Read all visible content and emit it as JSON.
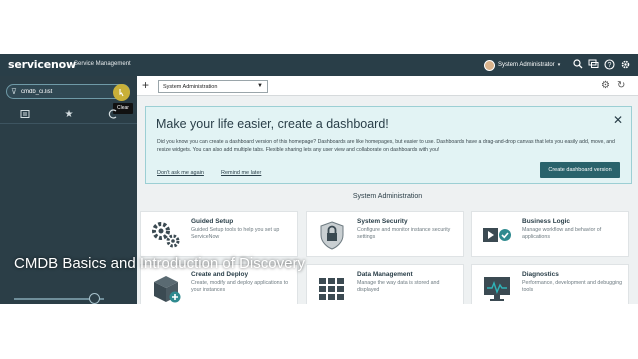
{
  "topbar": {
    "logo": "servicenow",
    "product": "Service Management",
    "user_name": "System Administrator",
    "user_caret": "▾",
    "icons": [
      "search-icon",
      "chat-icon",
      "help-icon",
      "gear-icon"
    ]
  },
  "leftnav": {
    "filter_value": "cmdb_ci.list",
    "filter_icon": "⊽",
    "clear_tooltip": "Clear",
    "tabs": [
      "history-icon",
      "star-icon",
      "clock-icon"
    ]
  },
  "tabbar": {
    "add_label": "+",
    "dashboard_selected": "System Administration",
    "caret": "▼",
    "gear": "⚙",
    "refresh": "↻"
  },
  "banner": {
    "title": "Make your life easier, create a dashboard!",
    "close": "✕",
    "body": "Did you know you can create a dashboard version of this homepage? Dashboards are like homepages, but easier to use. Dashboards have a drag-and-drop canvas that lets you easily add, move, and resize widgets. You can also add multiple tabs. Flexible sharing lets any user view and collaborate on dashboards with you!",
    "dismiss_label": "Don't ask me again",
    "remind_label": "Remind me later",
    "create_label": "Create dashboard version"
  },
  "section": {
    "title": "System Administration"
  },
  "cards": [
    {
      "title": "Guided Setup",
      "desc": "Guided Setup tools to help you set up ServiceNow",
      "icon": "gears-icon"
    },
    {
      "title": "System Security",
      "desc": "Configure and monitor instance security settings",
      "icon": "shield-icon"
    },
    {
      "title": "Business Logic",
      "desc": "Manage workflow and behavior of applications",
      "icon": "play-check-icon"
    },
    {
      "title": "Create and Deploy",
      "desc": "Create, modify and deploy applications to your instances",
      "icon": "box-add-icon"
    },
    {
      "title": "Data Management",
      "desc": "Manage the way data is stored and displayed",
      "icon": "grid-icon"
    },
    {
      "title": "Diagnostics",
      "desc": "Performance, development and debugging tools",
      "icon": "monitor-icon"
    }
  ],
  "caption": "CMDB Basics and Introduction of Discovery",
  "colors": {
    "header": "#293e48",
    "nav": "#2b3e47",
    "accent": "#29626b",
    "banner_bg": "#e2f3f4",
    "clear_button": "#c9b039"
  }
}
